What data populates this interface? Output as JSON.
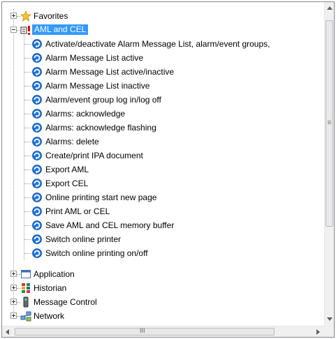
{
  "tree": {
    "favorites": {
      "label": "Favorites",
      "icon": "star-icon"
    },
    "aml_cel": {
      "label": "AML and CEL",
      "icon": "alarm-list-icon",
      "children": [
        "Activate/deactivate Alarm Message List, alarm/event groups,",
        "Alarm Message List active",
        "Alarm Message List active/inactive",
        "Alarm Message List inactive",
        "Alarm/event group log in/log off",
        "Alarms: acknowledge",
        "Alarms: acknowledge flashing",
        "Alarms: delete",
        "Create/print IPA document",
        "Export AML",
        "Export CEL",
        "Online printing start new page",
        "Print AML or CEL",
        "Save AML and CEL memory buffer",
        "Switch online printer",
        "Switch online printing on/off"
      ]
    },
    "application": {
      "label": "Application",
      "icon": "window-icon"
    },
    "historian": {
      "label": "Historian",
      "icon": "historian-icon"
    },
    "message_control": {
      "label": "Message Control",
      "icon": "device-icon"
    },
    "network": {
      "label": "Network",
      "icon": "network-icon"
    }
  },
  "scrollbars": {
    "h_grip": "III"
  },
  "colors": {
    "selection": "#3399ff",
    "function_icon": "#1e73d8"
  }
}
